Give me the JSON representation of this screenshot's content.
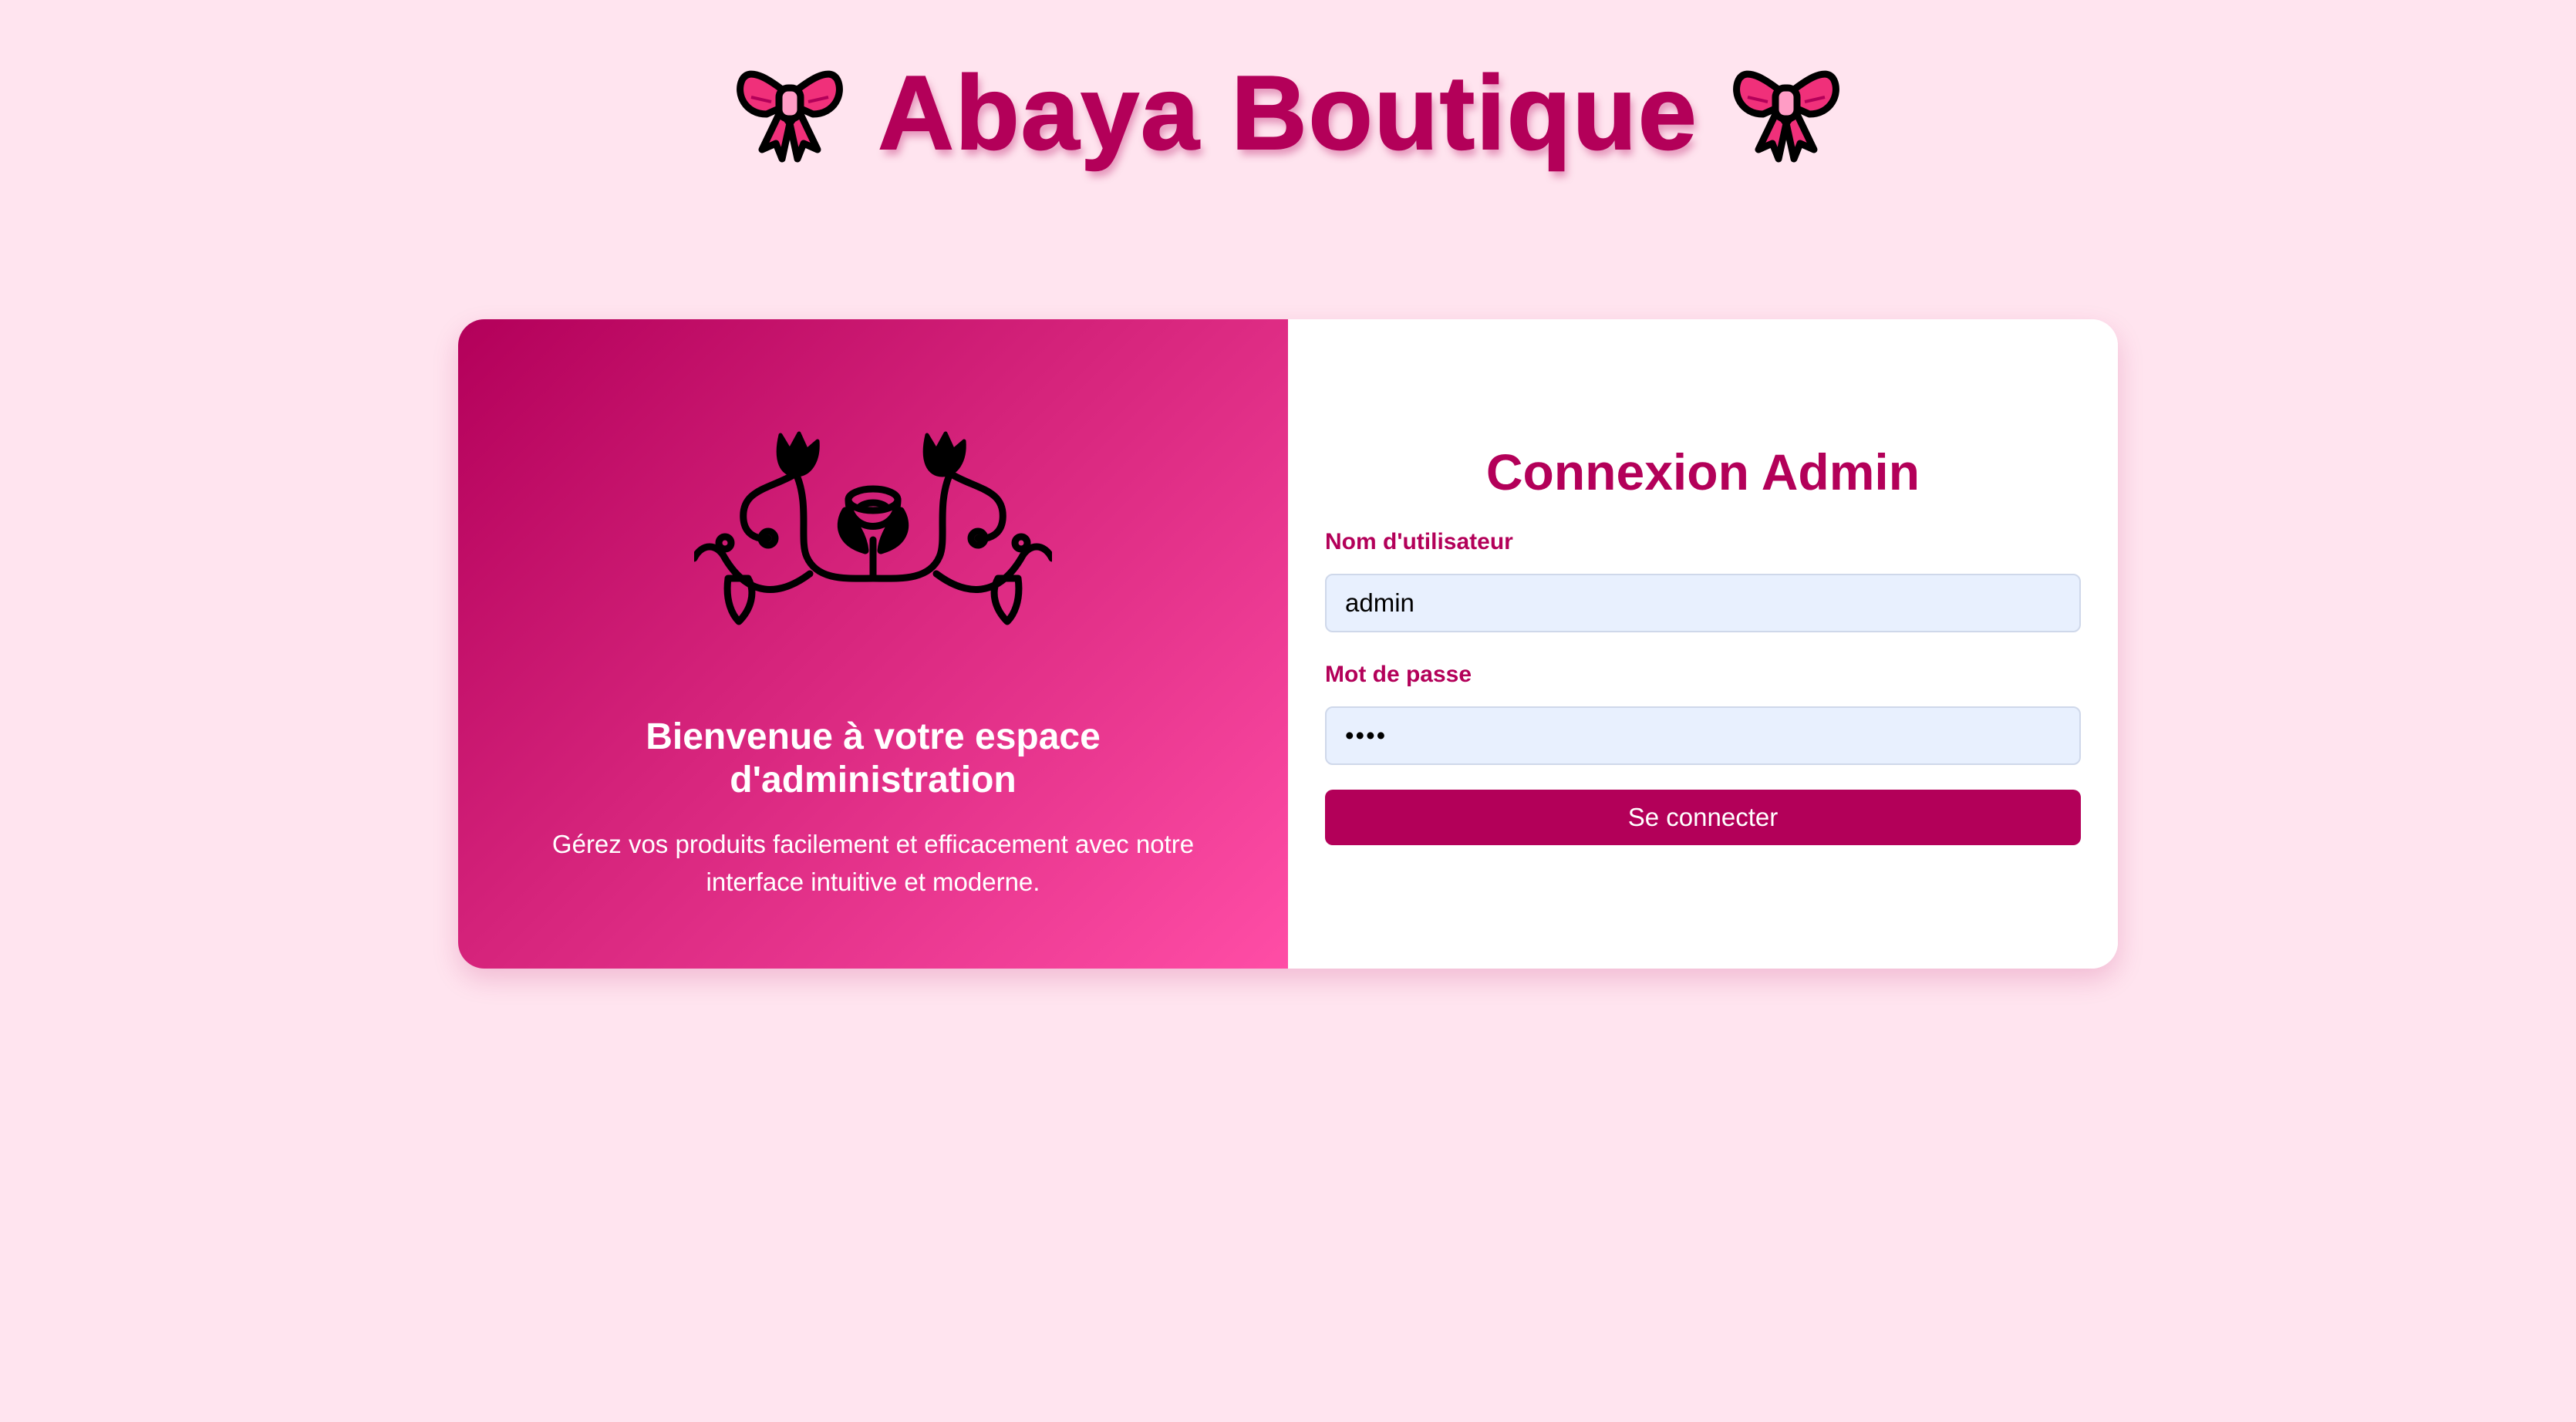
{
  "header": {
    "title": "Abaya Boutique",
    "left_icon": "ribbon-bow-icon",
    "right_icon": "ribbon-bow-icon"
  },
  "welcome_panel": {
    "icon": "rose-ornament-icon",
    "heading": "Bienvenue à votre espace d'administration",
    "description": "Gérez vos produits facilement et efficacement avec notre interface intuitive et moderne."
  },
  "login_form": {
    "title": "Connexion Admin",
    "username_label": "Nom d'utilisateur",
    "username_value": "admin",
    "password_label": "Mot de passe",
    "password_value": "••••",
    "submit_label": "Se connecter"
  },
  "colors": {
    "background": "#ffe4ef",
    "accent": "#b30059",
    "gradient_start": "#b3005a",
    "gradient_end": "#ff4da6",
    "input_background": "#e8f0fe"
  }
}
